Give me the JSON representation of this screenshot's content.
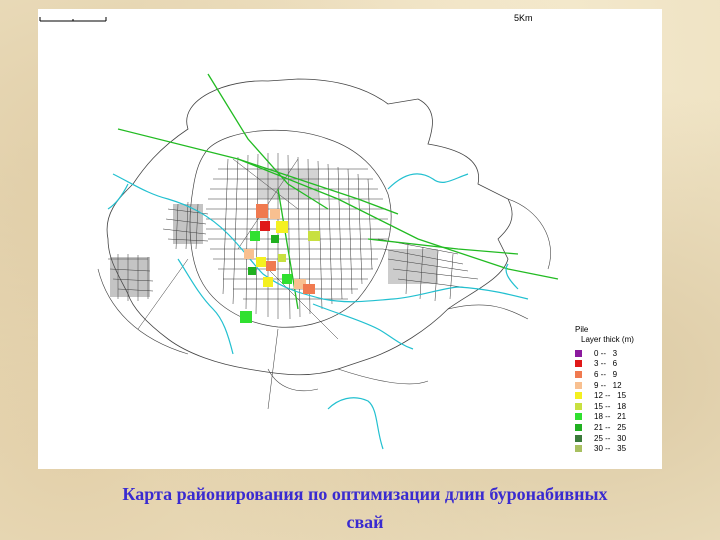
{
  "map": {
    "scale_label": "5Km",
    "legend": {
      "title": "Pile",
      "subtitle": "Layer thick (m)",
      "items": [
        {
          "label": "0 --   3",
          "color": "#8b1a9e"
        },
        {
          "label": "3 --   6",
          "color": "#e01818"
        },
        {
          "label": "6 --   9",
          "color": "#f07a50"
        },
        {
          "label": "9 --   12",
          "color": "#f8c090"
        },
        {
          "label": "12 --   15",
          "color": "#f4f020"
        },
        {
          "label": "15 --   18",
          "color": "#c8e040"
        },
        {
          "label": "18 --   21",
          "color": "#30e030"
        },
        {
          "label": "21 --   25",
          "color": "#20b020"
        },
        {
          "label": "25 --   30",
          "color": "#3a7a3a"
        },
        {
          "label": "30 --   35",
          "color": "#a8c060"
        }
      ]
    },
    "colors": {
      "roads": "#333333",
      "rail": "#22bb22",
      "rivers": "#22c0d0",
      "boundary": "#444444"
    }
  },
  "caption": {
    "line1": "Карта районирования по оптимизации длин буронабивных",
    "line2": "свай"
  }
}
